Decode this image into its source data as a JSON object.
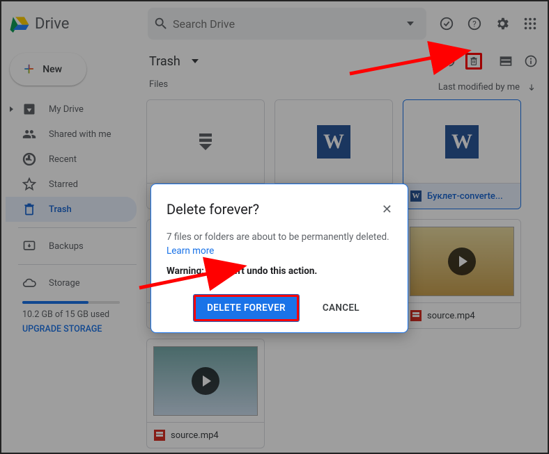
{
  "header": {
    "product": "Drive",
    "search_placeholder": "Search Drive"
  },
  "sidebar": {
    "new_label": "New",
    "items": [
      {
        "label": "My Drive"
      },
      {
        "label": "Shared with me"
      },
      {
        "label": "Recent"
      },
      {
        "label": "Starred"
      },
      {
        "label": "Trash"
      },
      {
        "label": "Backups"
      }
    ],
    "storage_label": "Storage",
    "storage_text": "10.2 GB of 15 GB used",
    "upgrade": "UPGRADE STORAGE"
  },
  "main": {
    "title": "Trash",
    "section": "Files",
    "sort": "Last modified by me",
    "files": [
      {
        "name": "",
        "type": "download"
      },
      {
        "name": "",
        "type": "word"
      },
      {
        "name": "Буклет-converte...",
        "type": "word",
        "selected": true
      },
      {
        "name": "source.mp4",
        "type": "video"
      },
      {
        "name": "source.mp4",
        "type": "video"
      },
      {
        "name": "source.mp4",
        "type": "video_desktop"
      },
      {
        "name": "source.mp4",
        "type": "video_city"
      }
    ]
  },
  "dialog": {
    "title": "Delete forever?",
    "body_text": "7 files or folders are about to be permanently deleted. ",
    "learn_more": "Learn more",
    "warning": "Warning: You can't undo this action.",
    "primary": "DELETE FOREVER",
    "secondary": "CANCEL"
  }
}
